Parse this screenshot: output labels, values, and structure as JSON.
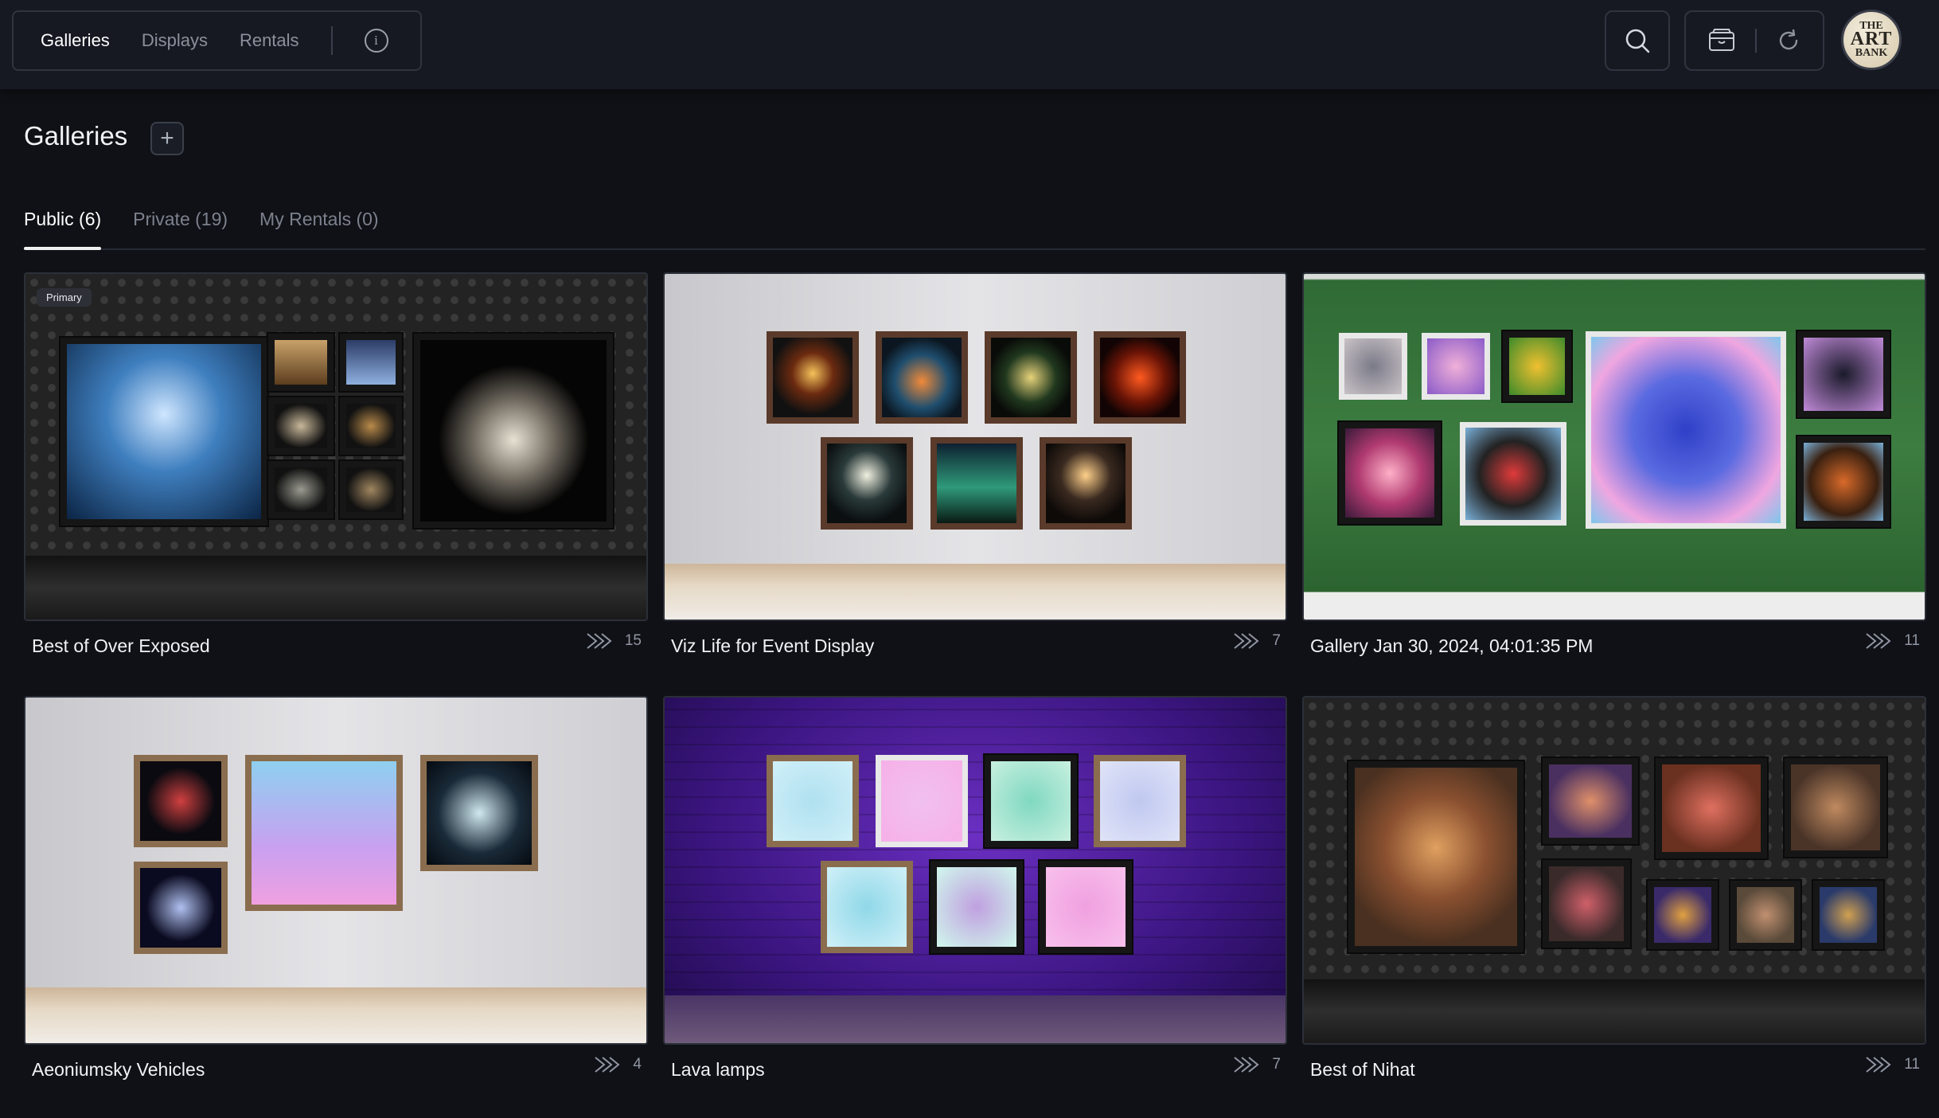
{
  "nav": {
    "items": [
      {
        "label": "Galleries",
        "active": true
      },
      {
        "label": "Displays",
        "active": false
      },
      {
        "label": "Rentals",
        "active": false
      }
    ]
  },
  "logo": {
    "line1": "THE",
    "line2": "ART",
    "line3": "BANK"
  },
  "page": {
    "title": "Galleries"
  },
  "tabs": [
    {
      "label": "Public (6)",
      "active": true
    },
    {
      "label": "Private (19)",
      "active": false
    },
    {
      "label": "My Rentals (0)",
      "active": false
    }
  ],
  "cards": [
    {
      "title": "Best of Over Exposed",
      "count": "15",
      "badge": "Primary"
    },
    {
      "title": "Viz Life for Event Display",
      "count": "7"
    },
    {
      "title": "Gallery Jan 30, 2024, 04:01:35 PM",
      "count": "11"
    },
    {
      "title": "Aeoniumsky Vehicles",
      "count": "4"
    },
    {
      "title": "Lava lamps",
      "count": "7"
    },
    {
      "title": "Best of Nihat",
      "count": "11"
    }
  ],
  "icons": {
    "info": "info-icon",
    "search": "search-icon",
    "wallet": "wallet-icon",
    "refresh": "refresh-icon",
    "add": "plus-icon",
    "views": "double-chevron-icon"
  }
}
